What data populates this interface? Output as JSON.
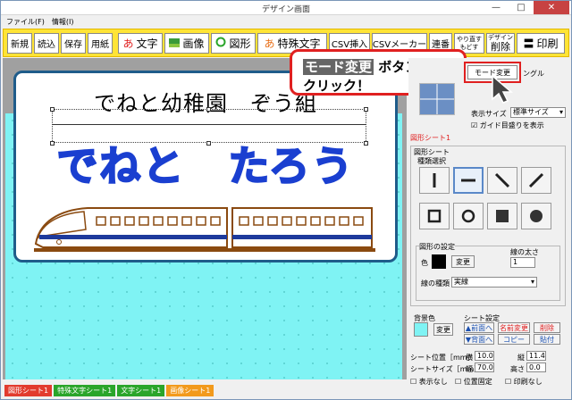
{
  "window": {
    "title": "デザイン画面",
    "minimize": "—",
    "maximize": "□",
    "close": "✕"
  },
  "menu": [
    "ファイル(F)",
    "情報(I)"
  ],
  "toolbar": {
    "new": "新規",
    "load": "読込",
    "save": "保存",
    "paper": "用紙",
    "text": "文字",
    "image": "画像",
    "shape": "図形",
    "special_text": "特殊文字",
    "csv_import": "CSV挿入",
    "csv_maker": "CSVメーカー",
    "multi": "連番",
    "redo_top": "やり直す",
    "redo_bottom": "もどす",
    "delete_top": "デザイン",
    "delete_bottom": "削除",
    "print": "印刷"
  },
  "canvas": {
    "line1": "でねと幼稚園　ぞう組",
    "line2": "でねと　たろう"
  },
  "callout": {
    "highlight": "モード変更",
    "line1_rest": " ボタンを",
    "line2": "クリック！"
  },
  "right_panel": {
    "mode_button": "モード変更",
    "mode_label": "ングル",
    "display_size_label": "表示サイズ",
    "display_size_value": "標準サイズ",
    "guide_checkbox": "ガイド目盛りを表示",
    "sheet_title": "図形シート1",
    "shape_sheet_group": "図形シート",
    "kind_group": "種類選択",
    "settings_group": "図形の設定",
    "line_width_label": "線の太さ",
    "line_width_value": "1",
    "color_label": "色",
    "change_button": "変更",
    "line_type_label": "線の種類",
    "line_type_value": "実線",
    "bg_color_label": "背景色",
    "bg_change": "変更",
    "sheet_settings_label": "シート設定",
    "front_btn": "▲前面へ",
    "back_btn": "▼背面へ",
    "name_change": "名前変更",
    "copy_btn": "コピー",
    "delete_btn": "削除",
    "paste_btn": "貼付",
    "sheet_pos_label": "シート位置［mm］",
    "x_label": "横",
    "x_value": "10.0",
    "y_label": "縦",
    "y_value": "11.4",
    "sheet_size_label": "シートサイズ［mm］",
    "w_label": "幅",
    "w_value": "70.0",
    "h_label": "高さ",
    "h_value": "0.0",
    "hide_label": "表示なし",
    "pos_fixed_label": "位置固定",
    "no_print_label": "印刷なし"
  },
  "sheet_tabs": [
    {
      "label": "図形シート1",
      "color": "#e23b2e"
    },
    {
      "label": "特殊文字シート1",
      "color": "#2aa52a"
    },
    {
      "label": "文字シート1",
      "color": "#2aa52a"
    },
    {
      "label": "画像シート1",
      "color": "#f29a1c"
    }
  ],
  "colors": {
    "toolbar": "#ffe436",
    "sheet_bg": "#7ff3f4",
    "name_text": "#1a3fd0",
    "callout_border": "#e02020"
  }
}
